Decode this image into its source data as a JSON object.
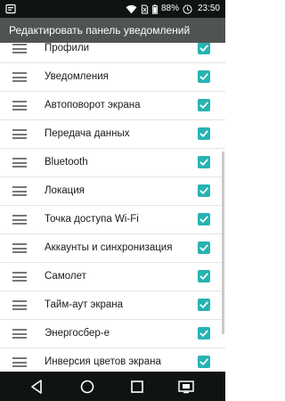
{
  "status_bar": {
    "left_icon": "notification-icon",
    "icons": [
      "wifi-icon",
      "no-sim-icon",
      "battery-icon"
    ],
    "battery_text": "88%",
    "time": "23:50"
  },
  "app_bar": {
    "title": "Редактировать панель уведомлений"
  },
  "items": [
    {
      "label": "Профили",
      "checked": true
    },
    {
      "label": "Уведомления",
      "checked": true
    },
    {
      "label": "Автоповорот экрана",
      "checked": true
    },
    {
      "label": "Передача данных",
      "checked": true
    },
    {
      "label": "Bluetooth",
      "checked": true
    },
    {
      "label": "Локация",
      "checked": true
    },
    {
      "label": "Точка доступа Wi-Fi",
      "checked": true
    },
    {
      "label": "Аккаунты и синхронизация",
      "checked": true
    },
    {
      "label": "Самолет",
      "checked": true
    },
    {
      "label": "Тайм-аут экрана",
      "checked": true
    },
    {
      "label": "Энергосбер-е",
      "checked": true
    },
    {
      "label": "Инверсия цветов экрана",
      "checked": true
    }
  ],
  "nav_bar": {
    "buttons": [
      "back-icon",
      "home-icon",
      "recents-icon",
      "screen-switch-icon"
    ]
  },
  "colors": {
    "status_bar": "#0f1413",
    "app_bar": "#4f5352",
    "accent": "#27b3b2",
    "nav_bar": "#0f1413"
  }
}
